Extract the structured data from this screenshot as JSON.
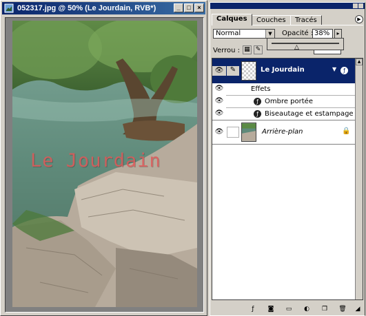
{
  "document": {
    "title": "052317.jpg @ 50% (Le Jourdain, RVB*)",
    "controls": {
      "minimize": "_",
      "maximize": "□",
      "close": "×"
    },
    "canvas_text": "Le Jourdain"
  },
  "palette": {
    "tabs": [
      "Calques",
      "Couches",
      "Tracés"
    ],
    "active_tab": "Calques",
    "blend_mode": "Normal",
    "opacity_label": "Opacité :",
    "opacity_value": "38%",
    "lock_label": "Verrou :",
    "layers": {
      "text_layer_name": "Le Jourdain",
      "effects_label": "Effets",
      "effect_1": "Ombre portée",
      "effect_2": "Biseautage et estampage",
      "background_layer_name": "Arrière-plan"
    }
  },
  "colors": {
    "titlebar": "#0a246a",
    "selected_layer": "#0a246a",
    "overlay_text": "#e05858",
    "chrome": "#d4d0c8"
  }
}
